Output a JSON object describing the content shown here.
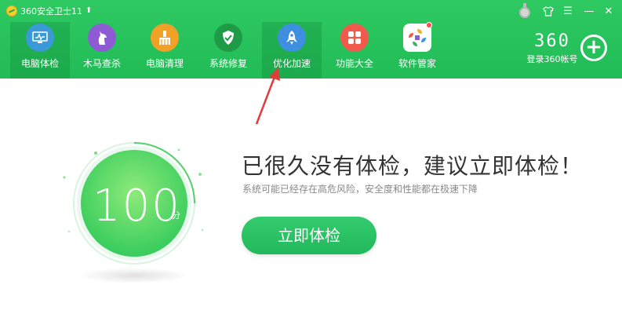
{
  "window": {
    "title": "360安全卫士11"
  },
  "window_controls": {
    "minimize": "—",
    "close": "✕",
    "menu": "☰"
  },
  "nav": [
    {
      "label": "电脑体检",
      "icon": "monitor-icon",
      "color": "#3a9ad9"
    },
    {
      "label": "木马查杀",
      "icon": "horse-icon",
      "color": "#8e5bd4"
    },
    {
      "label": "电脑清理",
      "icon": "broom-icon",
      "color": "#f1a126"
    },
    {
      "label": "系统修复",
      "icon": "shield-icon",
      "color": "#1f9a47"
    },
    {
      "label": "优化加速",
      "icon": "rocket-icon",
      "color": "#3f8fe0"
    },
    {
      "label": "功能大全",
      "icon": "grid-icon",
      "color": "#ef5a4c"
    },
    {
      "label": "软件管家",
      "icon": "apps-icon",
      "color": "#41b45f"
    }
  ],
  "login": {
    "logo_text": "360",
    "label": "登录360帐号"
  },
  "main": {
    "score": "100",
    "score_unit": "分",
    "headline": "已很久没有体检，建议立即体检！",
    "subtitle": "系统可能已经存在高危风险，安全度和性能都在极速下降",
    "button": "立即体检"
  },
  "colors": {
    "brand_green": "#22bc57",
    "arrow_red": "#e23b3b"
  }
}
